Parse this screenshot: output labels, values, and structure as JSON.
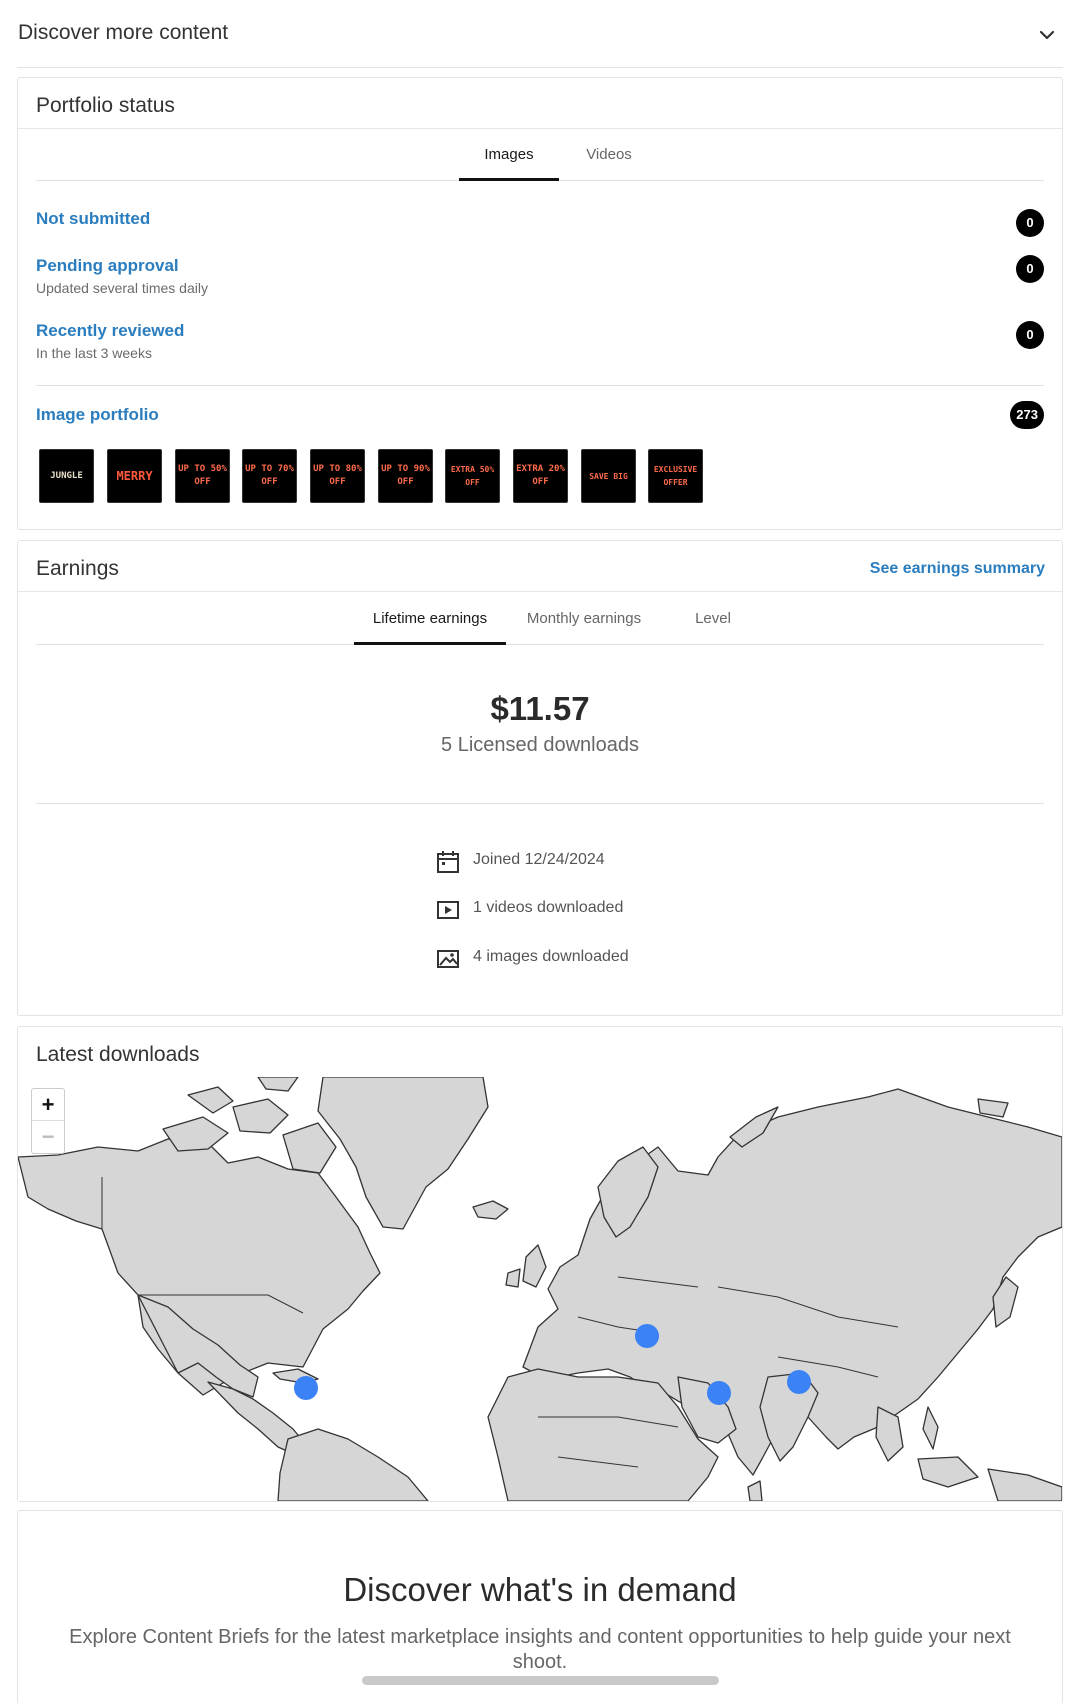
{
  "header": {
    "title": "Discover more content",
    "chevron_icon": "chevron-down-icon"
  },
  "portfolio": {
    "title": "Portfolio status",
    "tabs": [
      {
        "label": "Images",
        "active": true
      },
      {
        "label": "Videos",
        "active": false
      }
    ],
    "rows": [
      {
        "label": "Not submitted",
        "sub": "",
        "count": "0"
      },
      {
        "label": "Pending approval",
        "sub": "Updated several times daily",
        "count": "0"
      },
      {
        "label": "Recently reviewed",
        "sub": "In the last 3 weeks",
        "count": "0"
      }
    ],
    "image_portfolio": {
      "label": "Image portfolio",
      "count": "273"
    },
    "thumbnails": [
      "JUNGLE",
      "MERRY",
      "UP TO 50% OFF",
      "UP TO 70% OFF",
      "UP TO 80% OFF",
      "UP TO 90% OFF",
      "EXTRA 50% OFF",
      "EXTRA 20% OFF",
      "SAVE BIG",
      "EXCLUSIVE OFFER"
    ]
  },
  "earnings": {
    "title": "Earnings",
    "summary_link": "See earnings summary",
    "tabs": [
      {
        "label": "Lifetime earnings",
        "active": true
      },
      {
        "label": "Monthly earnings",
        "active": false
      },
      {
        "label": "Level",
        "active": false
      }
    ],
    "amount": "$11.57",
    "licensed": "5 Licensed downloads",
    "stats": [
      {
        "icon": "calendar-icon",
        "text": "Joined 12/24/2024"
      },
      {
        "icon": "video-icon",
        "text": "1 videos downloaded"
      },
      {
        "icon": "image-icon",
        "text": "4 images downloaded"
      }
    ]
  },
  "latest": {
    "title": "Latest downloads",
    "zoom_in": "+",
    "zoom_out": "−",
    "download_marker_color": "#3b82f6"
  },
  "demand": {
    "title": "Discover what's in demand",
    "description": "Explore Content Briefs for the latest marketplace insights and content opportunities to help guide your next shoot."
  }
}
